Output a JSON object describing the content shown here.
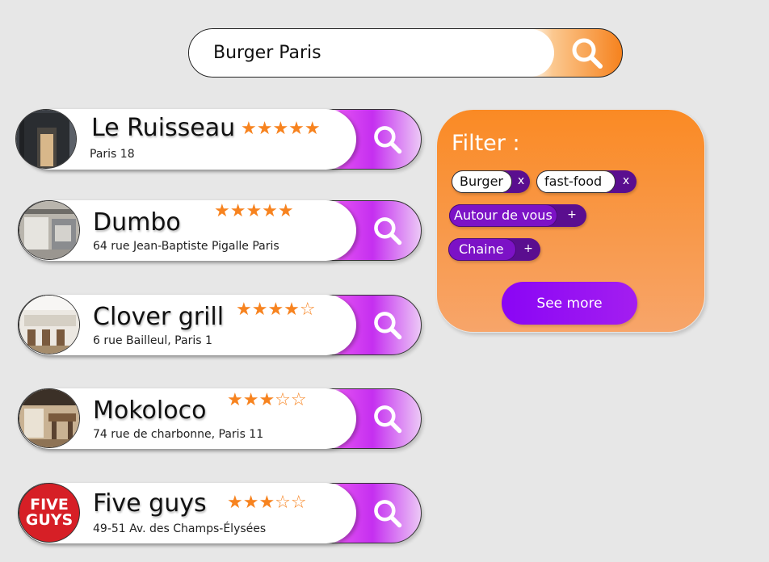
{
  "search": {
    "value": "Burger Paris",
    "button_icon": "search-icon",
    "accent": "#f6821e"
  },
  "results": [
    {
      "name": "Le Ruisseau",
      "address": "Paris 18",
      "rating": 5,
      "max_rating": 5,
      "stars": "★★★★★"
    },
    {
      "name": "Dumbo",
      "address": "64 rue Jean-Baptiste Pigalle Paris",
      "rating": 5,
      "max_rating": 5,
      "stars": "★★★★★"
    },
    {
      "name": "Clover grill",
      "address": "6 rue Bailleul,  Paris 1",
      "rating": 4,
      "max_rating": 5,
      "stars": "★★★★☆"
    },
    {
      "name": "Mokoloco",
      "address": "74 rue de charbonne, Paris 11",
      "rating": 3,
      "max_rating": 5,
      "stars": "★★★☆☆"
    },
    {
      "name": "Five guys",
      "address": "49-51 Av. des Champs-Élysées",
      "rating": 3,
      "max_rating": 5,
      "stars": "★★★☆☆",
      "logo_text_1": "FIVE",
      "logo_text_2": "GUYS"
    }
  ],
  "filter": {
    "title": "Filter :",
    "chips": [
      {
        "label": "Burger",
        "action": "x",
        "state": "active"
      },
      {
        "label": "fast-food",
        "action": "x",
        "state": "active"
      },
      {
        "label": "Autour de vous",
        "action": "+",
        "state": "inactive"
      },
      {
        "label": "Chaine",
        "action": "+",
        "state": "inactive"
      }
    ],
    "see_more_label": "See more"
  },
  "colors": {
    "card_accent": "#c52ff0",
    "star": "#f7831f",
    "chip_inactive": "#7c12c6",
    "see_more": "#8a05f5"
  }
}
